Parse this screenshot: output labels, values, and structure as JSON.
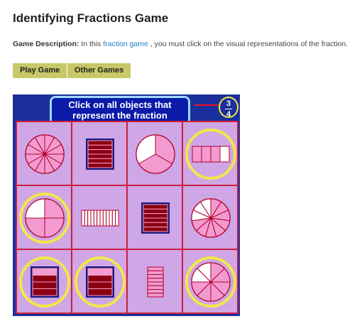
{
  "page": {
    "title": "Identifying Fractions Game",
    "description": {
      "label": "Game Description:",
      "pre": "In this",
      "link": "fraction game",
      "post": ", you must click on the visual representations of the fraction."
    },
    "buttons": {
      "play": "Play Game",
      "other": "Other Games"
    }
  },
  "game": {
    "instruction": "Click on all objects that represent the fraction",
    "fraction": {
      "numerator": "3",
      "denominator": "4"
    },
    "colors": {
      "background": "#1a2f9c",
      "board": "#cfa6e6",
      "piece": "#f39bd0",
      "bar": "#8a0013",
      "highlight": "#f3e64a"
    },
    "cells": [
      {
        "type": "pie",
        "parts": 12,
        "shaded": 12,
        "selected": false
      },
      {
        "type": "stack",
        "parts": 6,
        "shaded": 6,
        "selected": false
      },
      {
        "type": "pie",
        "parts": 3,
        "shaded": 2,
        "selected": false
      },
      {
        "type": "bar",
        "parts": 4,
        "shaded": 3,
        "selected": true
      },
      {
        "type": "pie",
        "parts": 4,
        "shaded": 3,
        "selected": true
      },
      {
        "type": "bar",
        "parts": 12,
        "shaded": 0,
        "selected": false
      },
      {
        "type": "stack",
        "parts": 6,
        "shaded": 6,
        "selected": false
      },
      {
        "type": "pie",
        "parts": 11,
        "shaded": 8,
        "selected": false
      },
      {
        "type": "stack",
        "parts": 4,
        "shaded": 3,
        "selected": true
      },
      {
        "type": "stack",
        "parts": 4,
        "shaded": 3,
        "selected": true
      },
      {
        "type": "stack",
        "parts": 8,
        "shaded": 0,
        "selected": false
      },
      {
        "type": "pie",
        "parts": 8,
        "shaded": 6,
        "selected": true
      }
    ]
  }
}
